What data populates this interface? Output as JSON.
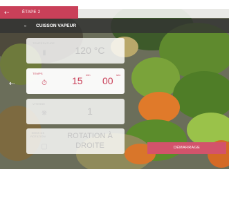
{
  "header": {
    "step_label": "ÉTAPE 2",
    "back_icon": "back-arrow-icon",
    "accent_color": "#c94059"
  },
  "mode": {
    "title": "CUISSON VAPEUR",
    "icon": "steam-pot-icon"
  },
  "nav": {
    "side_icon": "left-arrow-icon"
  },
  "fields": {
    "temperature": {
      "label": "TEMPÉRATURE",
      "value": "120 °C",
      "icon": "thermometer-icon"
    },
    "time": {
      "label": "TEMPS",
      "minutes": "15",
      "minutes_unit": "min",
      "seconds": "00",
      "seconds_unit": "sec",
      "icon": "timer-icon"
    },
    "speed": {
      "label": "VITESSE",
      "value": "1",
      "icon": "speed-fan-icon"
    },
    "rotation": {
      "label_line1": "SENS DE",
      "label_line2": "ROTATION",
      "value_line1": "ROTATION À",
      "value_line2": "DROITE",
      "icon": "rotation-icon"
    }
  },
  "start_button": {
    "label": "DÉMARRAGE"
  }
}
